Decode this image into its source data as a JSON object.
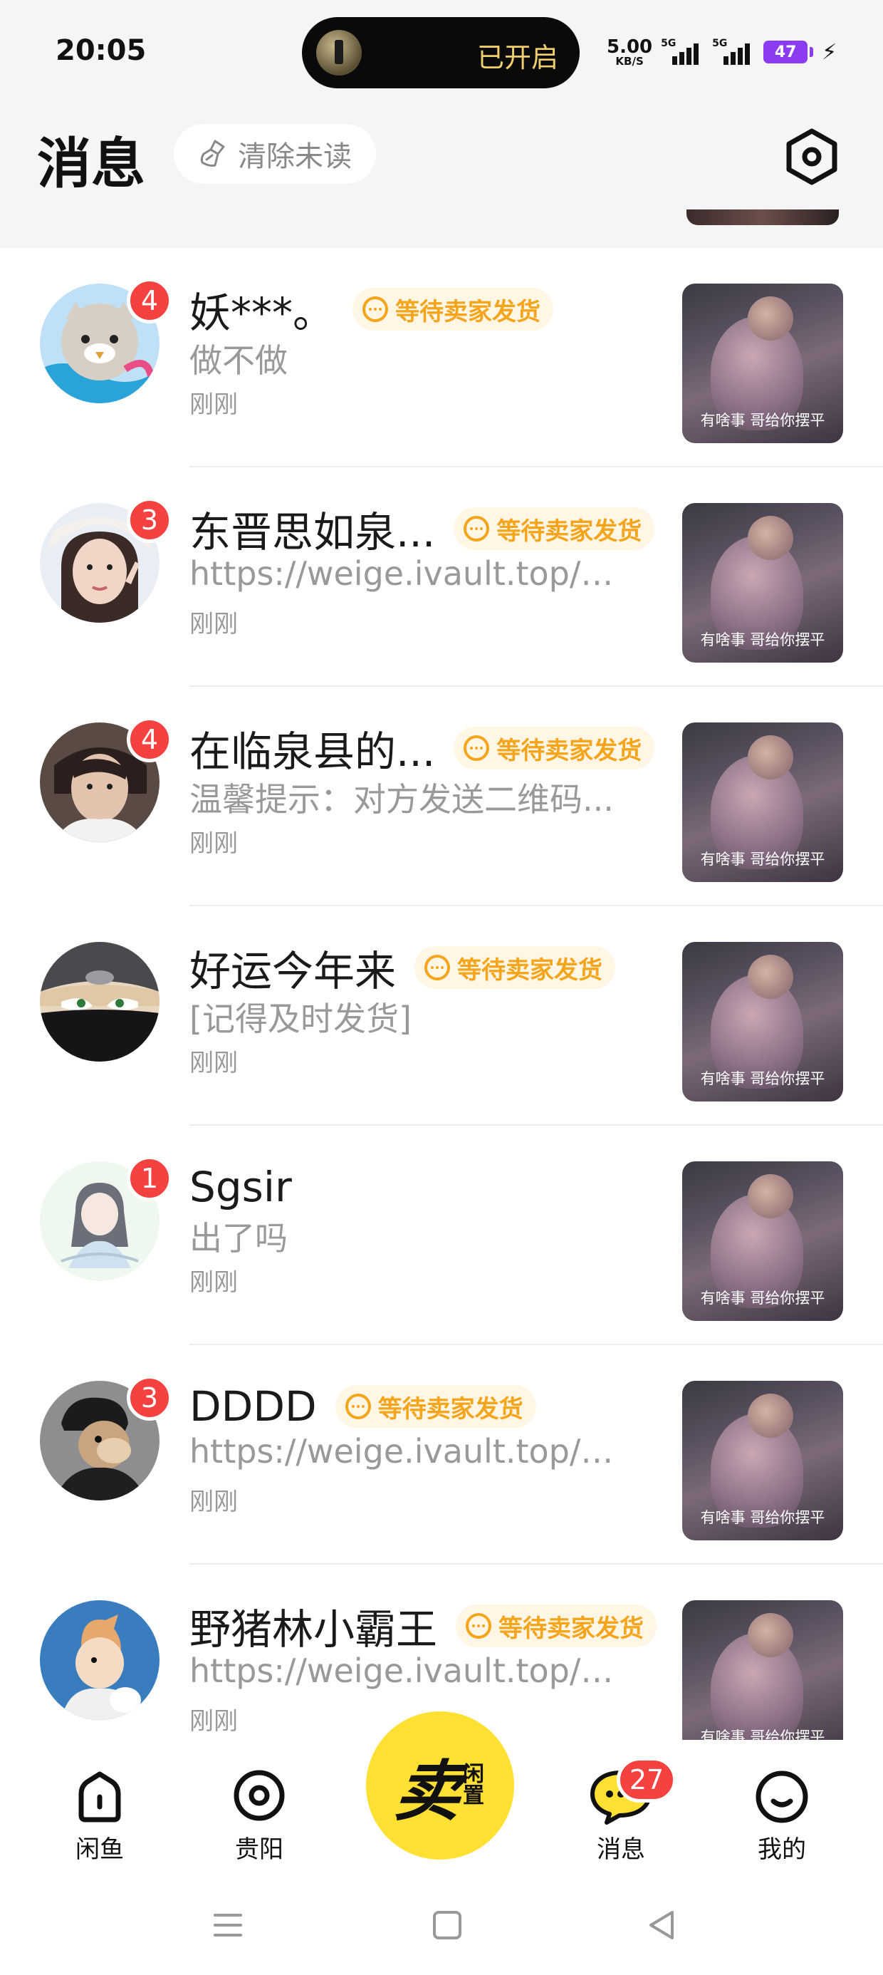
{
  "status_bar": {
    "time": "20:05",
    "pill_text": "已开启",
    "speed_value": "5.00",
    "speed_unit": "KB/S",
    "net1": "5G",
    "net2": "5G",
    "battery": "47"
  },
  "header": {
    "title": "消息",
    "clear_unread_label": "清除未读",
    "icons": {
      "clear": "broom-icon",
      "settings": "hexagon-settings-icon"
    }
  },
  "tag_text": "等待卖家发货",
  "thumbnail_caption": "有啥事 哥给你摆平",
  "conversations": [
    {
      "name": "妖***。",
      "badge": "4",
      "preview": "做不做",
      "time": "刚刚",
      "awaiting_shipment": true,
      "avatar": "seal-cartoon"
    },
    {
      "name": "东晋思如泉...",
      "badge": "3",
      "preview": "https://weige.ivault.top/#/...",
      "time": "刚刚",
      "awaiting_shipment": true,
      "avatar": "girl-photo"
    },
    {
      "name": "在临泉县的...",
      "badge": "4",
      "preview": "温馨提示：对方发送二维码...",
      "time": "刚刚",
      "awaiting_shipment": true,
      "avatar": "man-photo"
    },
    {
      "name": "好运今年来",
      "badge": "",
      "preview": "[记得及时发货]",
      "time": "刚刚",
      "awaiting_shipment": true,
      "avatar": "masked-ninja"
    },
    {
      "name": "Sgsir",
      "badge": "1",
      "preview": "出了吗",
      "time": "刚刚",
      "awaiting_shipment": false,
      "avatar": "anime-girl"
    },
    {
      "name": "DDDD",
      "badge": "3",
      "preview": "https://weige.ivault.top/#/...",
      "time": "刚刚",
      "awaiting_shipment": true,
      "avatar": "cartoon-monkey"
    },
    {
      "name": "野猪林小霸王",
      "badge": "",
      "preview": "https://weige.ivault.top/#/...",
      "time": "刚刚",
      "awaiting_shipment": true,
      "avatar": "tintin-cartoon"
    }
  ],
  "tab_bar": {
    "tabs": [
      {
        "label": "闲鱼",
        "icon": "home-icon"
      },
      {
        "label": "贵阳",
        "icon": "location-icon"
      },
      {
        "label": "消息",
        "icon": "chat-bubble-icon",
        "badge": "27"
      },
      {
        "label": "我的",
        "icon": "smiley-icon"
      }
    ],
    "sell_main": "卖",
    "sell_sub": [
      "闲",
      "置"
    ]
  },
  "nav_bar": {
    "icons": [
      "menu-icon",
      "home-square-icon",
      "back-triangle-icon"
    ]
  },
  "colors": {
    "accent_yellow": "#ffe033",
    "badge_red": "#f5413f",
    "tag_orange": "#f4a51c",
    "header_bg": "#f5f5f5"
  }
}
